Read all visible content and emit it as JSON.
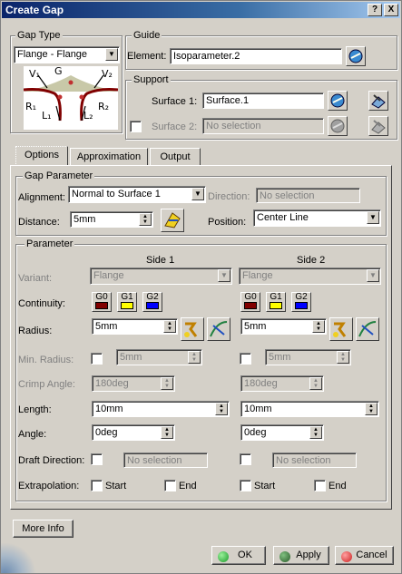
{
  "window": {
    "title": "Create Gap",
    "help_label": "?",
    "close_label": "X"
  },
  "gap_type": {
    "group_label": "Gap Type",
    "selected": "Flange - Flange",
    "diagram": {
      "g": "G",
      "v1": "V₁",
      "v2": "V₂",
      "r1": "R₁",
      "r2": "R₂",
      "l1": "L₁",
      "l2": "L₂"
    }
  },
  "guide": {
    "group_label": "Guide",
    "element_label": "Element:",
    "element_value": "Isoparameter.2"
  },
  "support": {
    "group_label": "Support",
    "surface1_label": "Surface 1:",
    "surface1_value": "Surface.1",
    "surface2_label": "Surface 2:",
    "surface2_placeholder": "No selection"
  },
  "tabs": [
    "Options",
    "Approximation",
    "Output"
  ],
  "gap_parameter": {
    "group_label": "Gap Parameter",
    "alignment_label": "Alignment:",
    "alignment_value": "Normal to Surface 1",
    "direction_label": "Direction:",
    "direction_placeholder": "No selection",
    "distance_label": "Distance:",
    "distance_value": "5mm",
    "position_label": "Position:",
    "position_value": "Center Line"
  },
  "parameter": {
    "group_label": "Parameter",
    "side1_header": "Side 1",
    "side2_header": "Side 2",
    "variant_label": "Variant:",
    "continuity_label": "Continuity:",
    "radius_label": "Radius:",
    "min_radius_label": "Min. Radius:",
    "crimp_angle_label": "Crimp Angle:",
    "length_label": "Length:",
    "angle_label": "Angle:",
    "draft_direction_label": "Draft Direction:",
    "extrapolation_label": "Extrapolation:",
    "continuity_options": [
      "G0",
      "G1",
      "G2"
    ],
    "continuity_colors": [
      "#800000",
      "#ffff00",
      "#0000ff"
    ],
    "start_label": "Start",
    "end_label": "End",
    "side1": {
      "variant": "Flange",
      "radius": "5mm",
      "min_radius": "5mm",
      "crimp_angle": "180deg",
      "length": "10mm",
      "angle": "0deg",
      "draft_placeholder": "No selection"
    },
    "side2": {
      "variant": "Flange",
      "radius": "5mm",
      "min_radius": "5mm",
      "crimp_angle": "180deg",
      "length": "10mm",
      "angle": "0deg",
      "draft_placeholder": "No selection"
    }
  },
  "footer": {
    "more_info": "More Info",
    "ok": "OK",
    "apply": "Apply",
    "cancel": "Cancel",
    "ok_color": "#1a9a2a",
    "apply_color": "#2a5a2a",
    "cancel_color": "#cc2020"
  }
}
